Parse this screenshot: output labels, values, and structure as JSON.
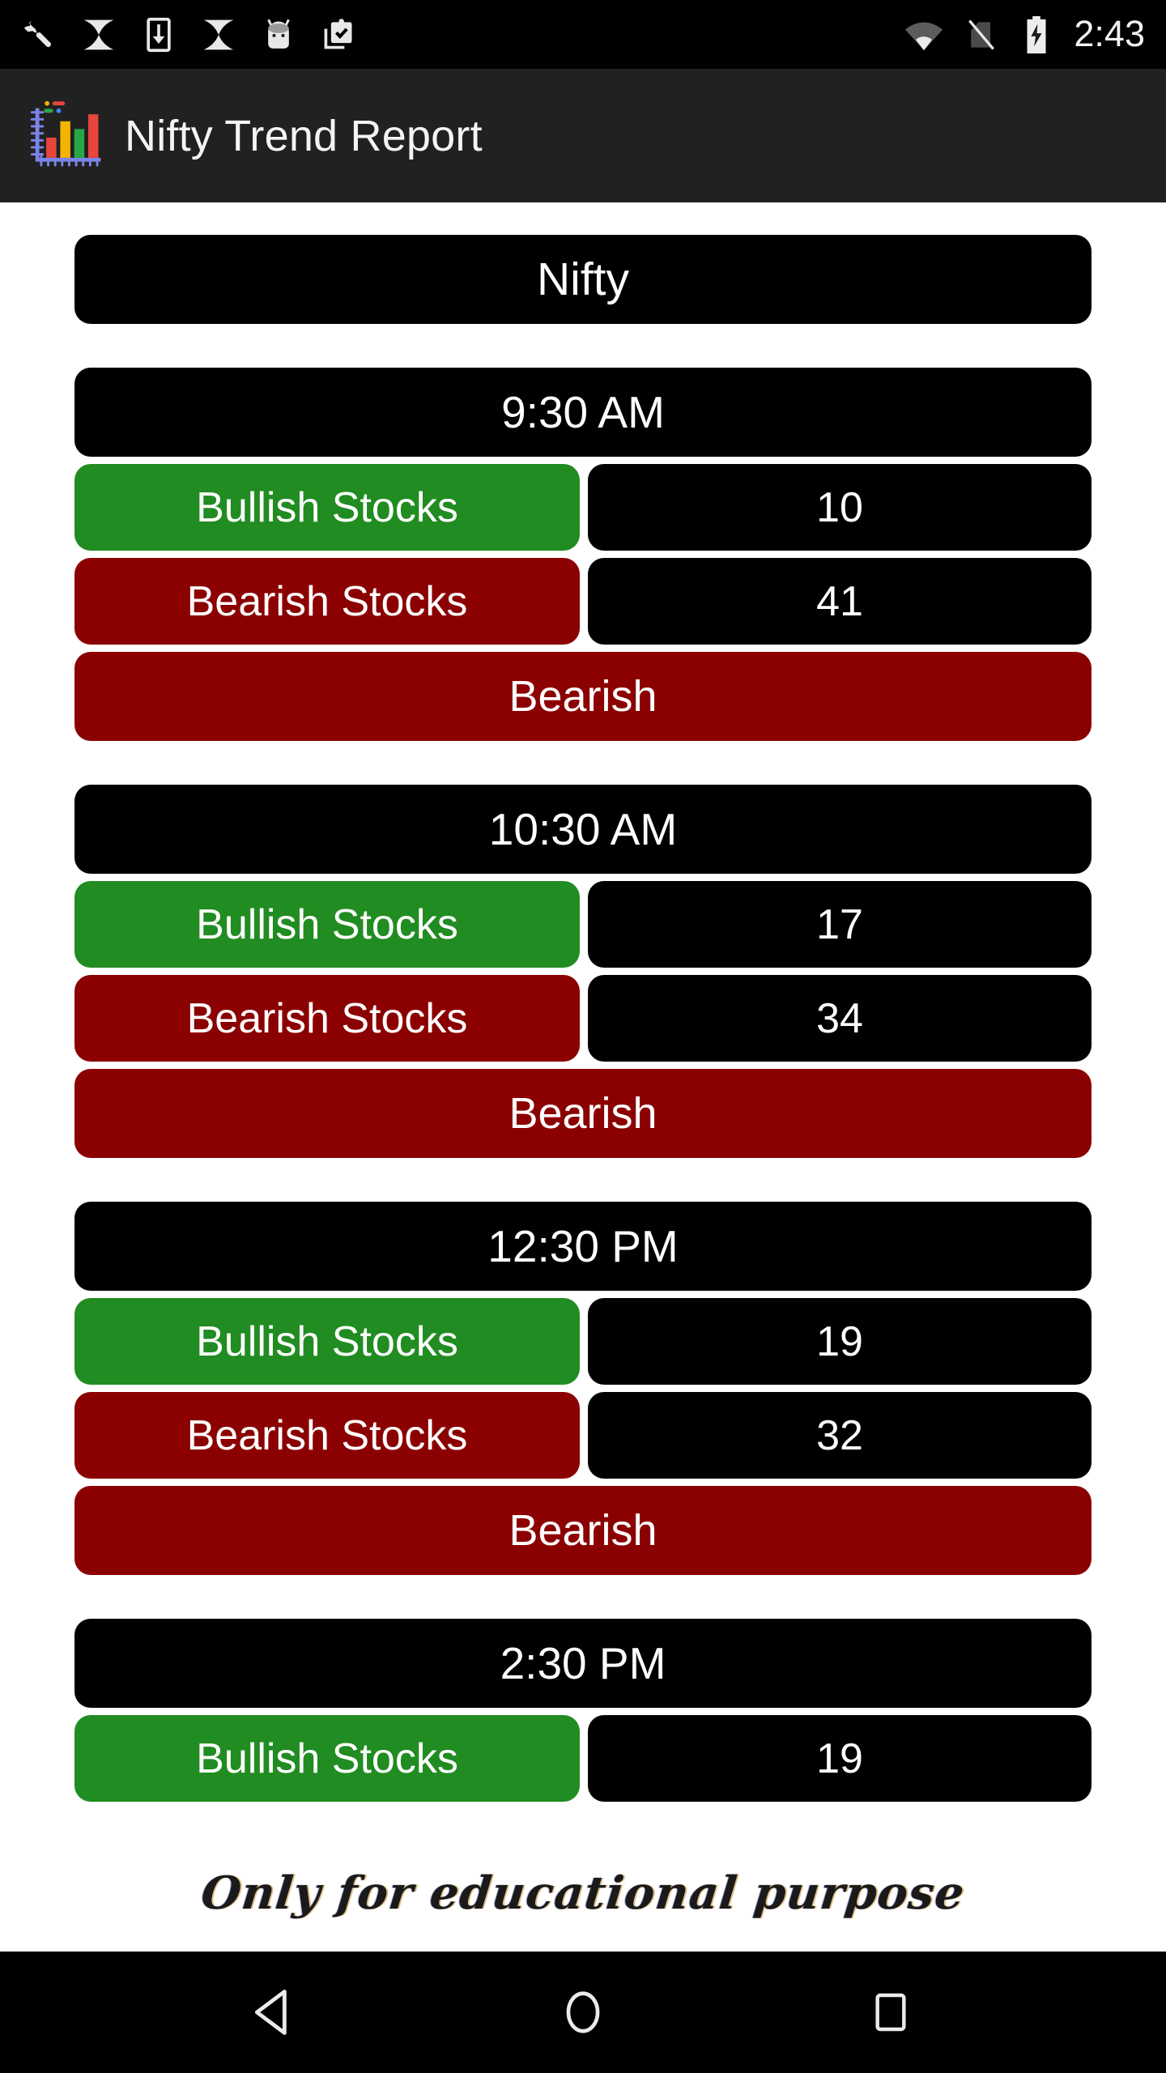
{
  "status_bar": {
    "time": "2:43",
    "notification_icons": [
      "wrench-icon",
      "sparkle-icon",
      "download-to-device-icon",
      "sparkle-icon",
      "android-head-icon",
      "clipboard-check-icon"
    ],
    "system_icons": [
      "wifi-icon",
      "no-sim-icon",
      "battery-charging-icon"
    ]
  },
  "app_bar": {
    "title": "Nifty Trend Report",
    "logo": "bar-chart-icon"
  },
  "report": {
    "index_name": "Nifty",
    "labels": {
      "bullish": "Bullish Stocks",
      "bearish": "Bearish Stocks"
    },
    "sections": [
      {
        "time": "9:30 AM",
        "bullish": "10",
        "bearish": "41",
        "trend": "Bearish"
      },
      {
        "time": "10:30 AM",
        "bullish": "17",
        "bearish": "34",
        "trend": "Bearish"
      },
      {
        "time": "12:30 PM",
        "bullish": "19",
        "bearish": "32",
        "trend": "Bearish"
      },
      {
        "time": "2:30 PM",
        "bullish": "19",
        "bearish": "",
        "trend": ""
      }
    ]
  },
  "watermark": {
    "text": "Only for educational purpose"
  },
  "nav_bar": {
    "back": "back-triangle-icon",
    "home": "home-circle-icon",
    "recents": "recents-square-icon"
  },
  "colors": {
    "bullish": "#218c21",
    "bearish": "#8b0000",
    "card": "#000000",
    "app_bar": "#212121",
    "background": "#ffffff"
  }
}
